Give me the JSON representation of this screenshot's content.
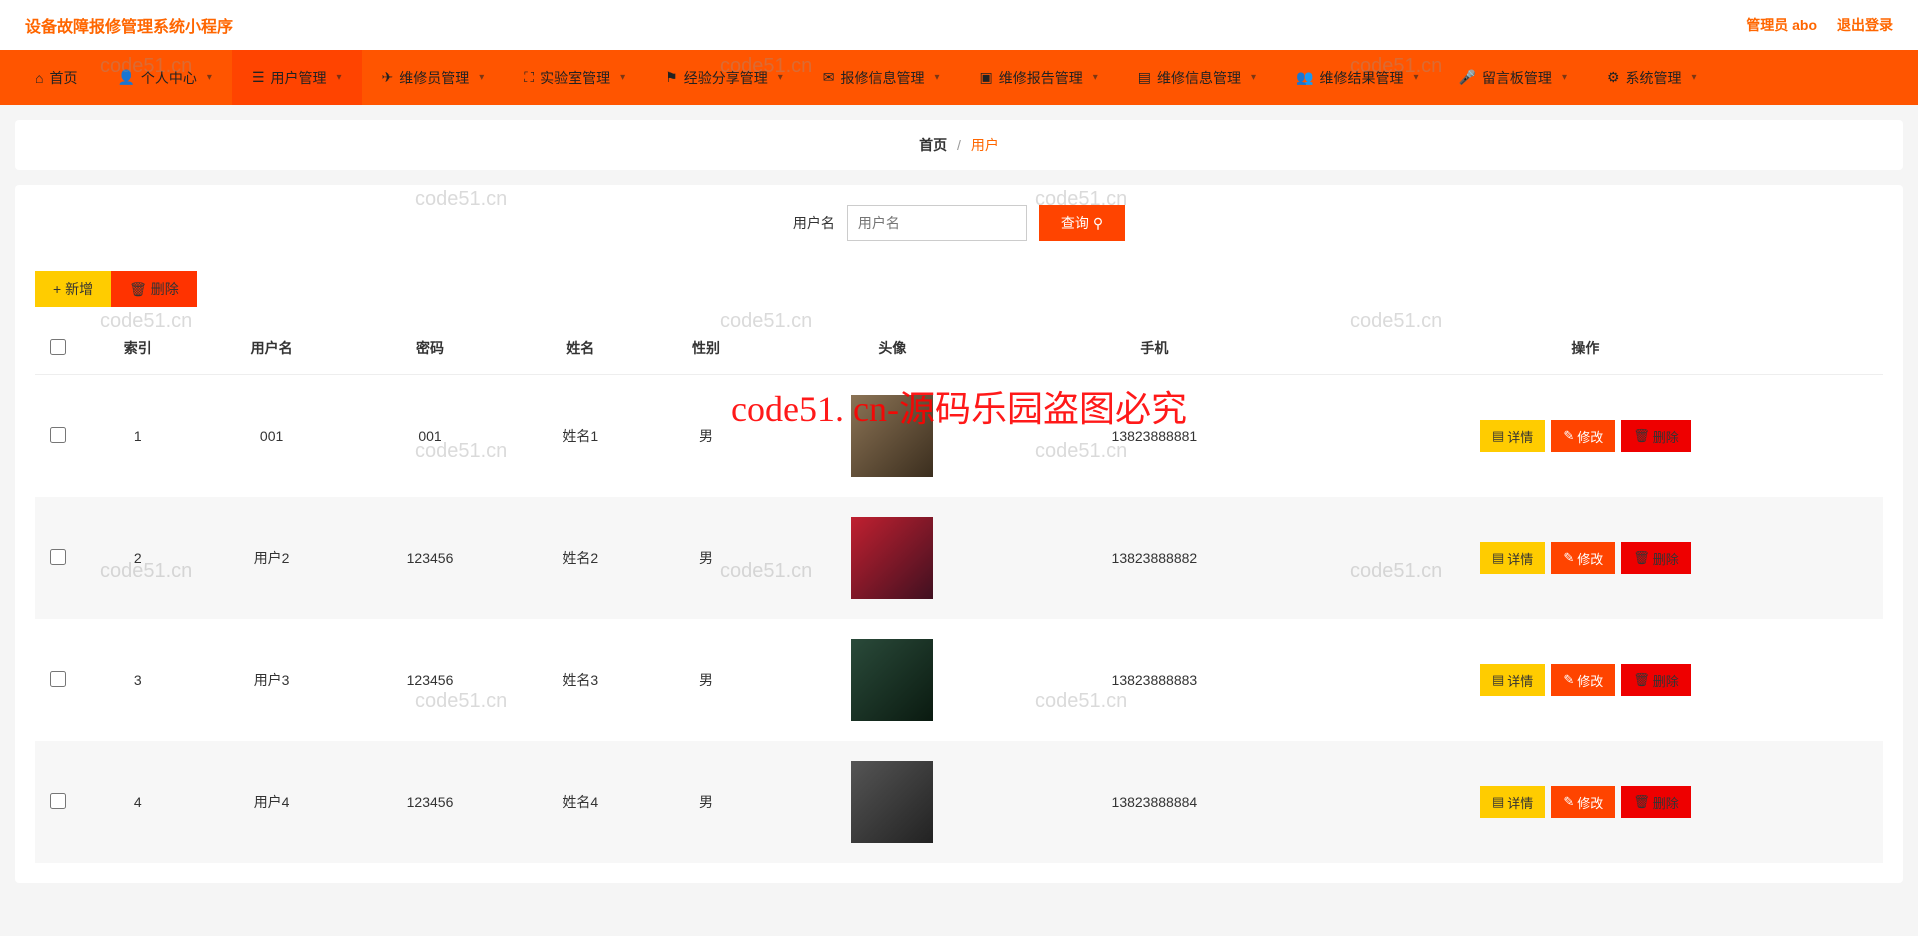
{
  "header": {
    "title": "设备故障报修管理系统小程序",
    "admin_label": "管理员 abo",
    "logout_label": "退出登录"
  },
  "nav": {
    "items": [
      {
        "icon": "⌂",
        "label": "首页",
        "chev": false
      },
      {
        "icon": "👤",
        "label": "个人中心",
        "chev": true
      },
      {
        "icon": "☰",
        "label": "用户管理",
        "chev": true,
        "active": true
      },
      {
        "icon": "✈",
        "label": "维修员管理",
        "chev": true
      },
      {
        "icon": "⛶",
        "label": "实验室管理",
        "chev": true
      },
      {
        "icon": "⚑",
        "label": "经验分享管理",
        "chev": true
      },
      {
        "icon": "✉",
        "label": "报修信息管理",
        "chev": true
      },
      {
        "icon": "▣",
        "label": "维修报告管理",
        "chev": true
      },
      {
        "icon": "▤",
        "label": "维修信息管理",
        "chev": true
      },
      {
        "icon": "👥",
        "label": "维修结果管理",
        "chev": true
      },
      {
        "icon": "🎤",
        "label": "留言板管理",
        "chev": true
      },
      {
        "icon": "⚙",
        "label": "系统管理",
        "chev": true
      }
    ]
  },
  "breadcrumb": {
    "home": "首页",
    "current": "用户"
  },
  "search": {
    "label": "用户名",
    "placeholder": "用户名",
    "button": "查询"
  },
  "toolbar": {
    "add": "新增",
    "delete": "删除"
  },
  "table": {
    "columns": [
      "索引",
      "用户名",
      "密码",
      "姓名",
      "性别",
      "头像",
      "手机",
      "操作"
    ],
    "rows": [
      {
        "idx": "1",
        "username": "001",
        "password": "001",
        "name": "姓名1",
        "gender": "男",
        "phone": "13823888881",
        "avatar": "av1"
      },
      {
        "idx": "2",
        "username": "用户2",
        "password": "123456",
        "name": "姓名2",
        "gender": "男",
        "phone": "13823888882",
        "avatar": "av2"
      },
      {
        "idx": "3",
        "username": "用户3",
        "password": "123456",
        "name": "姓名3",
        "gender": "男",
        "phone": "13823888883",
        "avatar": "av3"
      },
      {
        "idx": "4",
        "username": "用户4",
        "password": "123456",
        "name": "姓名4",
        "gender": "男",
        "phone": "13823888884",
        "avatar": "av4"
      }
    ],
    "actions": {
      "detail": "详情",
      "edit": "修改",
      "delete": "删除"
    }
  },
  "watermark_main": "code51. cn-源码乐园盗图必究",
  "watermark_small": "code51.cn"
}
